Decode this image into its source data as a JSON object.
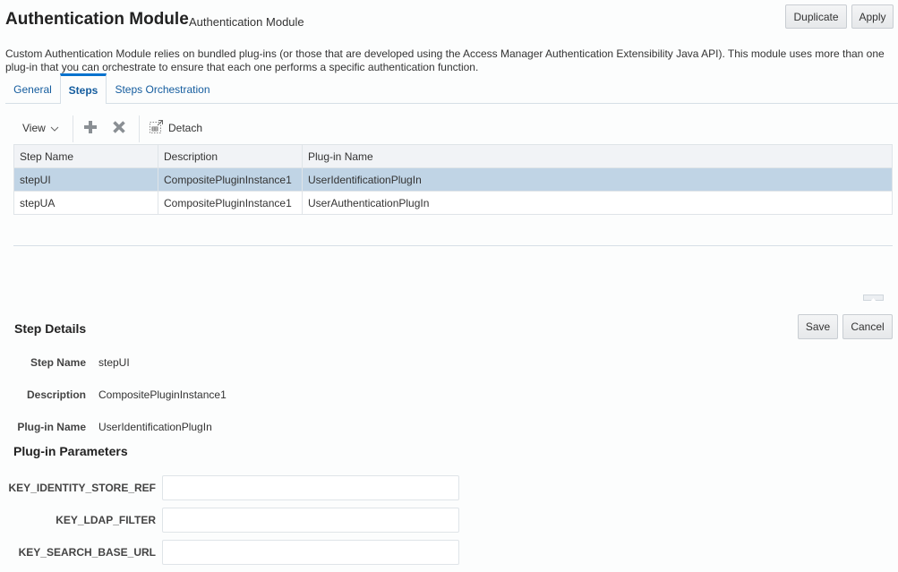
{
  "header": {
    "title": "Authentication Module",
    "subtitle": "Authentication Module",
    "duplicate_label": "Duplicate",
    "apply_label": "Apply"
  },
  "description": "Custom Authentication Module relies on bundled plug-ins (or those that are developed using the Access Manager Authentication Extensibility Java API). This module uses more than one plug-in that you can orchestrate to ensure that each one performs a specific authentication function.",
  "tabs": [
    {
      "label": "General",
      "active": false
    },
    {
      "label": "Steps",
      "active": true
    },
    {
      "label": "Steps Orchestration",
      "active": false
    }
  ],
  "toolbar": {
    "view_label": "View",
    "view_icon": "chevron-down-icon",
    "add_icon": "plus-icon",
    "delete_icon": "x-icon",
    "detach_icon": "detach-icon",
    "detach_label": "Detach"
  },
  "table": {
    "columns": [
      "Step Name",
      "Description",
      "Plug-in Name"
    ],
    "rows": [
      {
        "step_name": "stepUI",
        "description": "CompositePluginInstance1",
        "plugin_name": "UserIdentificationPlugIn",
        "selected": true
      },
      {
        "step_name": "stepUA",
        "description": "CompositePluginInstance1",
        "plugin_name": "UserAuthenticationPlugIn",
        "selected": false
      }
    ]
  },
  "step_details": {
    "heading": "Step Details",
    "save_label": "Save",
    "cancel_label": "Cancel",
    "fields": [
      {
        "label": "Step Name",
        "value": "stepUI"
      },
      {
        "label": "Description",
        "value": "CompositePluginInstance1"
      },
      {
        "label": "Plug-in Name",
        "value": "UserIdentificationPlugIn"
      }
    ]
  },
  "plugin_parameters": {
    "heading": "Plug-in Parameters",
    "params": [
      {
        "label": "KEY_IDENTITY_STORE_REF",
        "value": ""
      },
      {
        "label": "KEY_LDAP_FILTER",
        "value": ""
      },
      {
        "label": "KEY_SEARCH_BASE_URL",
        "value": ""
      }
    ]
  },
  "colors": {
    "accent": "#0572ce",
    "tab_text": "#145c9e",
    "selected_row": "#c0d4e5",
    "header_bg": "#f1f3f6"
  }
}
